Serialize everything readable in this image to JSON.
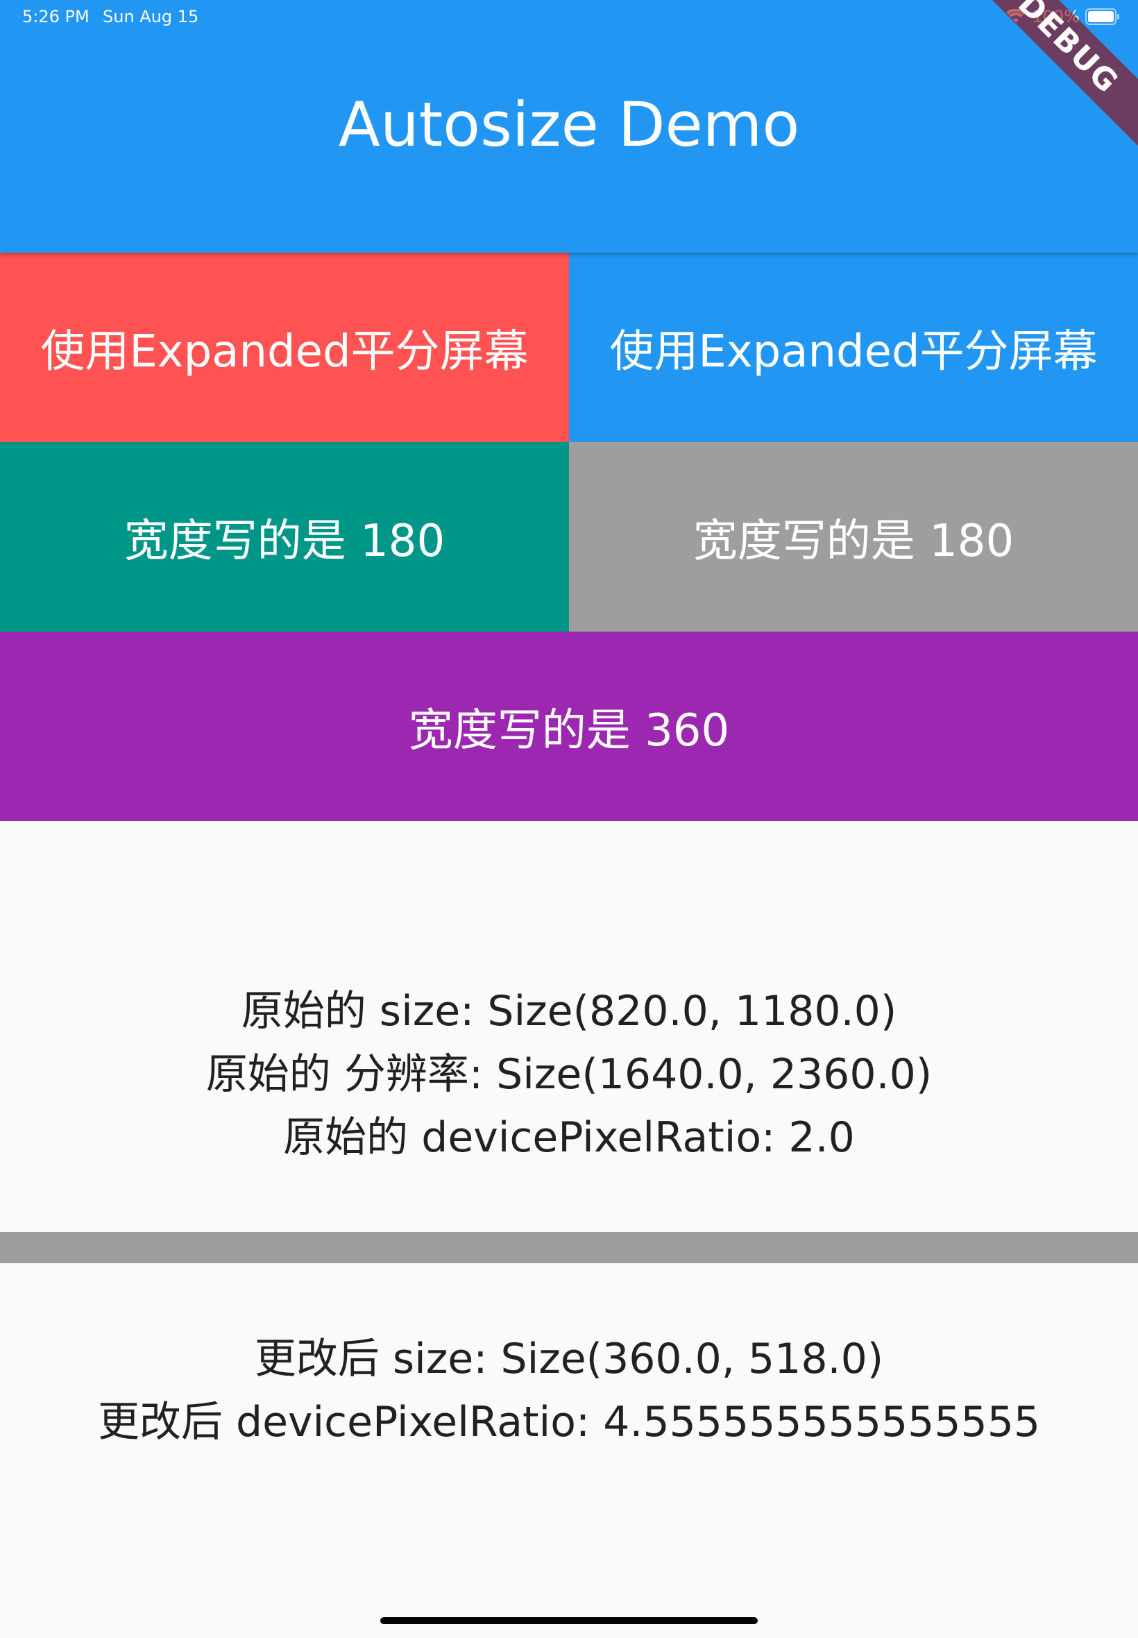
{
  "status_bar": {
    "time": "5:26 PM",
    "date": "Sun Aug 15",
    "battery": "100%",
    "wifi_icon": "wifi-icon",
    "battery_icon": "battery-icon"
  },
  "app_bar": {
    "title": "Autosize Demo",
    "color": "#2196f3"
  },
  "debug_banner": "DEBUG",
  "rows": [
    {
      "cells": [
        {
          "label": "使用Expanded平分屏幕",
          "color": "#ff5252"
        },
        {
          "label": "使用Expanded平分屏幕",
          "color": "#2196f3"
        }
      ]
    },
    {
      "cells": [
        {
          "label": "宽度写的是 180",
          "color": "#009688"
        },
        {
          "label": "宽度写的是 180",
          "color": "#9e9e9e"
        }
      ]
    },
    {
      "cells": [
        {
          "label": "宽度写的是 360",
          "color": "#9c27b0"
        }
      ]
    }
  ],
  "original_info": [
    "原始的 size: Size(820.0, 1180.0)",
    "原始的 分辨率: Size(1640.0, 2360.0)",
    "原始的 devicePixelRatio: 2.0"
  ],
  "changed_info": [
    "更改后 size: Size(360.0, 518.0)",
    "更改后 devicePixelRatio: 4.555555555555555"
  ]
}
